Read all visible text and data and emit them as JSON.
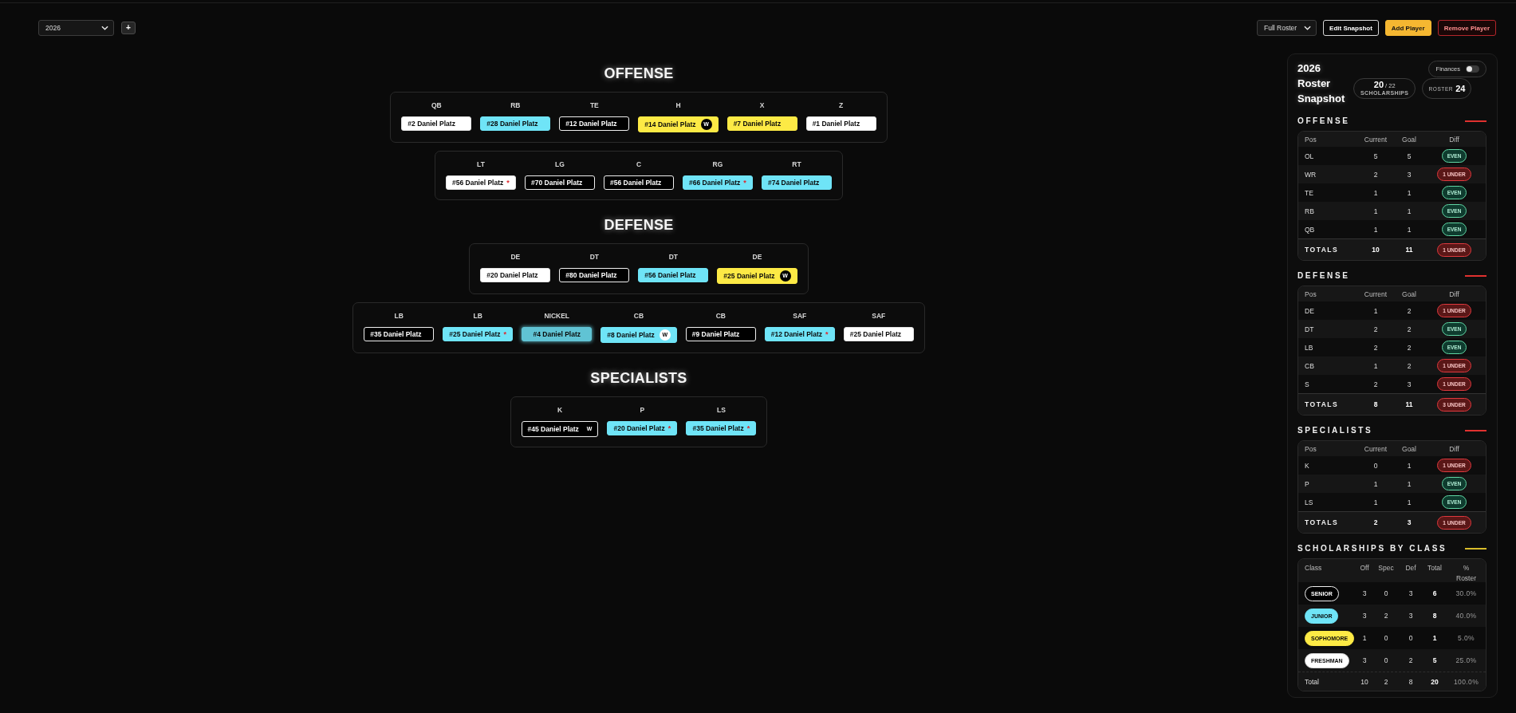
{
  "toolbar": {
    "season_select": {
      "value": "2026"
    },
    "add_season_button": {
      "label": "+"
    },
    "view_select": {
      "value": "Full Roster"
    },
    "buttons": [
      {
        "label": "Edit Snapshot",
        "kind": "outline"
      },
      {
        "label": "Add Player",
        "kind": "primary"
      },
      {
        "label": "Remove Player",
        "kind": "danger"
      }
    ]
  },
  "depth_chart": [
    {
      "title": "OFFENSE",
      "groups": [
        {
          "players": [
            {
              "position": "QB",
              "player": "#2 Daniel Platz",
              "kind": "freshman",
              "dragging": false
            },
            {
              "position": "RB",
              "player": "#28 Daniel Platz",
              "kind": "junior",
              "dragging": false
            },
            {
              "position": "TE",
              "player": "#12 Daniel Platz",
              "kind": "senior",
              "dragging": false
            },
            {
              "position": "H",
              "player": "#14 Daniel Platz",
              "kind": "sophomore",
              "dragging": false,
              "badge": "W"
            },
            {
              "position": "X",
              "player": "#7 Daniel Platz",
              "kind": "sophomore",
              "dragging": false
            },
            {
              "position": "Z",
              "player": "#1 Daniel Platz",
              "kind": "freshman",
              "dragging": false
            }
          ]
        },
        {
          "players": [
            {
              "position": "LT",
              "player": "#56 Daniel Platz",
              "kind": "freshman",
              "dragging": false,
              "flag": "*"
            },
            {
              "position": "LG",
              "player": "#70 Daniel Platz",
              "kind": "senior",
              "dragging": false
            },
            {
              "position": "C",
              "player": "#56 Daniel Platz",
              "kind": "senior",
              "dragging": false
            },
            {
              "position": "RG",
              "player": "#66 Daniel Platz",
              "kind": "junior",
              "dragging": false,
              "flag": "*"
            },
            {
              "position": "RT",
              "player": "#74 Daniel Platz",
              "kind": "junior",
              "dragging": false
            }
          ]
        }
      ]
    },
    {
      "title": "DEFENSE",
      "groups": [
        {
          "players": [
            {
              "position": "DE",
              "player": "#20 Daniel Platz",
              "kind": "freshman",
              "dragging": false
            },
            {
              "position": "DT",
              "player": "#80 Daniel Platz",
              "kind": "senior",
              "dragging": false
            },
            {
              "position": "DT",
              "player": "#56 Daniel Platz",
              "kind": "junior",
              "dragging": false
            },
            {
              "position": "DE",
              "player": "#25 Daniel Platz",
              "kind": "sophomore",
              "dragging": false,
              "badge": "W"
            }
          ]
        },
        {
          "players": [
            {
              "position": "LB",
              "player": "#35 Daniel Platz",
              "kind": "senior",
              "dragging": false
            },
            {
              "position": "LB",
              "player": "#25 Daniel Platz",
              "kind": "junior",
              "dragging": false,
              "flag": "*"
            },
            {
              "position": "NICKEL",
              "player": "#4 Daniel Platz",
              "kind": "junior",
              "dragging": true
            },
            {
              "position": "CB",
              "player": "#8 Daniel Platz",
              "kind": "junior",
              "dragging": false,
              "badge": "W"
            },
            {
              "position": "CB",
              "player": "#9 Daniel Platz",
              "kind": "senior",
              "dragging": false
            },
            {
              "position": "SAF",
              "player": "#12 Daniel Platz",
              "kind": "junior",
              "dragging": false,
              "flag": "*"
            },
            {
              "position": "SAF",
              "player": "#25 Daniel Platz",
              "kind": "freshman",
              "dragging": false
            }
          ]
        }
      ]
    },
    {
      "title": "SPECIALISTS",
      "groups": [
        {
          "players": [
            {
              "position": "K",
              "player": "#45 Daniel Platz",
              "kind": "senior",
              "dragging": false,
              "badge": "W"
            },
            {
              "position": "P",
              "player": "#20 Daniel Platz",
              "kind": "junior",
              "dragging": false,
              "flag": "*"
            },
            {
              "position": "LS",
              "player": "#35 Daniel Platz",
              "kind": "junior",
              "dragging": false,
              "flag": "*"
            }
          ]
        }
      ]
    }
  ],
  "snapshot": {
    "title": "2026 Roster Snapshot",
    "finances": {
      "label": "Finances",
      "on": false
    },
    "scholarships": {
      "count": "**20** / 22",
      "label": "SCHOLARSHIPS"
    },
    "roster": {
      "label": "ROSTER",
      "count": "24"
    },
    "position_tables": [
      {
        "title": "OFFENSE",
        "columns": [
          "Pos",
          "Current",
          "Goal",
          "Diff"
        ],
        "rows": [
          {
            "pos": "OL",
            "current": "5",
            "goal": "5",
            "diff": "EVEN",
            "kind": "even"
          },
          {
            "pos": "WR",
            "current": "2",
            "goal": "3",
            "diff": "1 UNDER",
            "kind": "under"
          },
          {
            "pos": "TE",
            "current": "1",
            "goal": "1",
            "diff": "EVEN",
            "kind": "even"
          },
          {
            "pos": "RB",
            "current": "1",
            "goal": "1",
            "diff": "EVEN",
            "kind": "even"
          },
          {
            "pos": "QB",
            "current": "1",
            "goal": "1",
            "diff": "EVEN",
            "kind": "even"
          }
        ],
        "totals": {
          "label": "TOTALS",
          "current": "10",
          "goal": "11",
          "diff": "1 UNDER",
          "kind": "under"
        }
      },
      {
        "title": "DEFENSE",
        "columns": [
          "Pos",
          "Current",
          "Goal",
          "Diff"
        ],
        "rows": [
          {
            "pos": "DE",
            "current": "1",
            "goal": "2",
            "diff": "1 UNDER",
            "kind": "under"
          },
          {
            "pos": "DT",
            "current": "2",
            "goal": "2",
            "diff": "EVEN",
            "kind": "even"
          },
          {
            "pos": "LB",
            "current": "2",
            "goal": "2",
            "diff": "EVEN",
            "kind": "even"
          },
          {
            "pos": "CB",
            "current": "1",
            "goal": "2",
            "diff": "1 UNDER",
            "kind": "under"
          },
          {
            "pos": "S",
            "current": "2",
            "goal": "3",
            "diff": "1 UNDER",
            "kind": "under"
          }
        ],
        "totals": {
          "label": "TOTALS",
          "current": "8",
          "goal": "11",
          "diff": "3 UNDER",
          "kind": "under"
        }
      },
      {
        "title": "SPECIALISTS",
        "columns": [
          "Pos",
          "Current",
          "Goal",
          "Diff"
        ],
        "rows": [
          {
            "pos": "K",
            "current": "0",
            "goal": "1",
            "diff": "1 UNDER",
            "kind": "under"
          },
          {
            "pos": "P",
            "current": "1",
            "goal": "1",
            "diff": "EVEN",
            "kind": "even"
          },
          {
            "pos": "LS",
            "current": "1",
            "goal": "1",
            "diff": "EVEN",
            "kind": "even"
          }
        ],
        "totals": {
          "label": "TOTALS",
          "current": "2",
          "goal": "3",
          "diff": "1 UNDER",
          "kind": "under"
        }
      }
    ],
    "class_table": {
      "title": "SCHOLARSHIPS BY CLASS",
      "columns": [
        "Class",
        "Off",
        "Spec",
        "Def",
        "Total",
        "% Roster"
      ],
      "rows": [
        {
          "class": "SENIOR",
          "kind": "senior",
          "off": "3",
          "spec": "0",
          "def": "3",
          "total": "6",
          "percent": "30.0%"
        },
        {
          "class": "JUNIOR",
          "kind": "junior",
          "off": "3",
          "spec": "2",
          "def": "3",
          "total": "8",
          "percent": "40.0%"
        },
        {
          "class": "SOPHOMORE",
          "kind": "sophomore",
          "off": "1",
          "spec": "0",
          "def": "0",
          "total": "1",
          "percent": "5.0%"
        },
        {
          "class": "FRESHMAN",
          "kind": "freshman",
          "off": "3",
          "spec": "0",
          "def": "2",
          "total": "5",
          "percent": "25.0%"
        }
      ],
      "totals": {
        "label": "Total",
        "off": "10",
        "spec": "2",
        "def": "8",
        "total": "20",
        "percent": "100.0%"
      }
    }
  }
}
